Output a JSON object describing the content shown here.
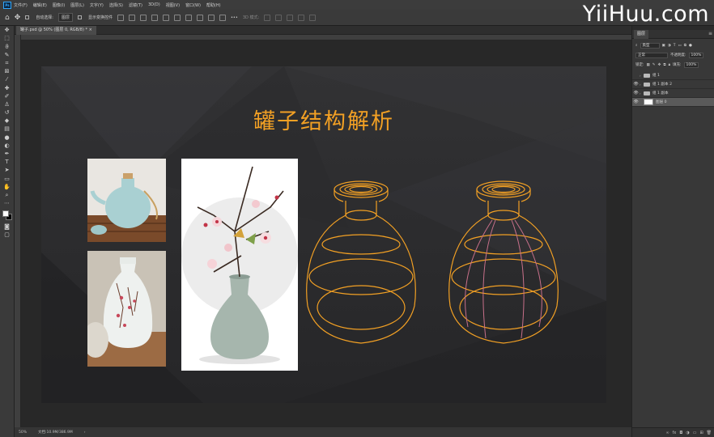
{
  "app": {
    "icon_text": "Ps"
  },
  "menu": [
    "文件(F)",
    "编辑(E)",
    "图像(I)",
    "图层(L)",
    "文字(Y)",
    "选择(S)",
    "滤镜(T)",
    "3D(D)",
    "视图(V)",
    "窗口(W)",
    "帮助(H)"
  ],
  "watermark": "YiiHuu.com",
  "options": {
    "auto_select_label": "自动选择:",
    "auto_select_value": "图层",
    "show_transform_label": "显示变换控件",
    "mode_3d_label": "3D 模式:"
  },
  "document": {
    "tab_title": "罐子.psd @ 50% (图层 0, RGB/8) *"
  },
  "canvas": {
    "title": "罐子结构解析"
  },
  "status": {
    "zoom": "50%",
    "doc_size": "文档:10.9M/386.9M"
  },
  "layers_panel": {
    "tab_label": "图层",
    "filter_kind": "类型",
    "blend_mode": "正常",
    "opacity_label": "不透明度:",
    "opacity_value": "100%",
    "lock_label": "锁定:",
    "fill_label": "填充:",
    "fill_value": "100%",
    "layers": [
      {
        "name": "组 1",
        "visible": false,
        "type": "group"
      },
      {
        "name": "组 1 副本 2",
        "visible": true,
        "type": "group"
      },
      {
        "name": "组 1 副本",
        "visible": true,
        "type": "group"
      },
      {
        "name": "图层 0",
        "visible": true,
        "type": "layer",
        "selected": true
      }
    ]
  },
  "colors": {
    "accent": "#f2a024",
    "pink_line": "#c8708a",
    "bg": "#282828"
  }
}
